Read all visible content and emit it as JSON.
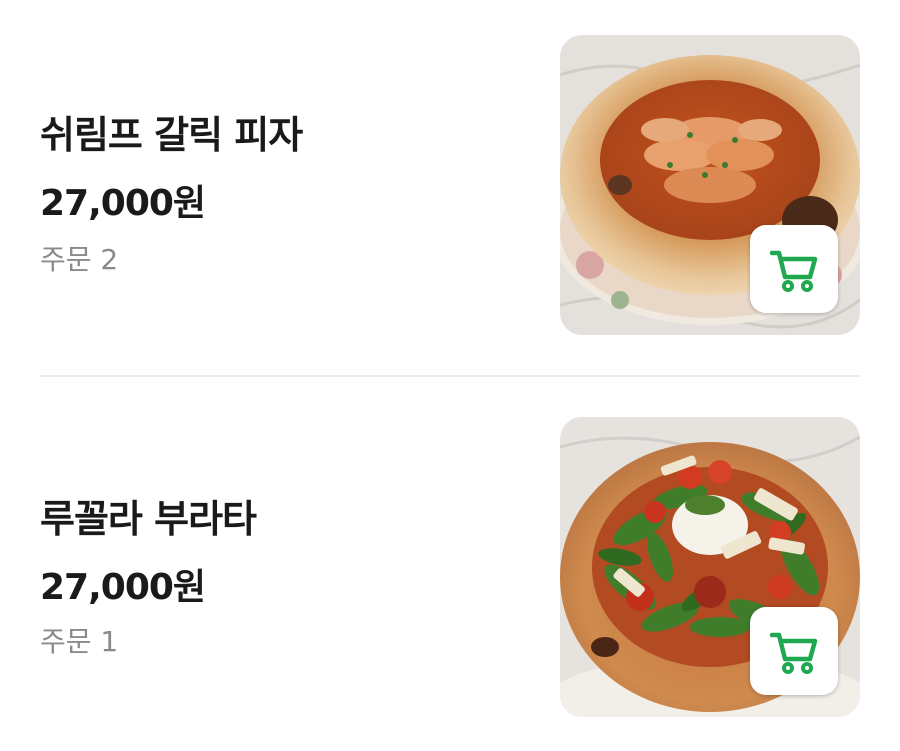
{
  "colors": {
    "cart_icon": "#1fa84f",
    "text_primary": "#1a1a1a",
    "text_secondary": "#8a8a8a",
    "divider": "#ececec"
  },
  "menu": {
    "items": [
      {
        "name": "쉬림프 갈릭 피자",
        "price": "27,000원",
        "orders": "주문 2",
        "photo_icon": "pizza-shrimp-photo",
        "cart_icon": "cart-icon"
      },
      {
        "name": "루꼴라 부라타",
        "price": "27,000원",
        "orders": "주문 1",
        "photo_icon": "pizza-burrata-photo",
        "cart_icon": "cart-icon"
      }
    ]
  }
}
